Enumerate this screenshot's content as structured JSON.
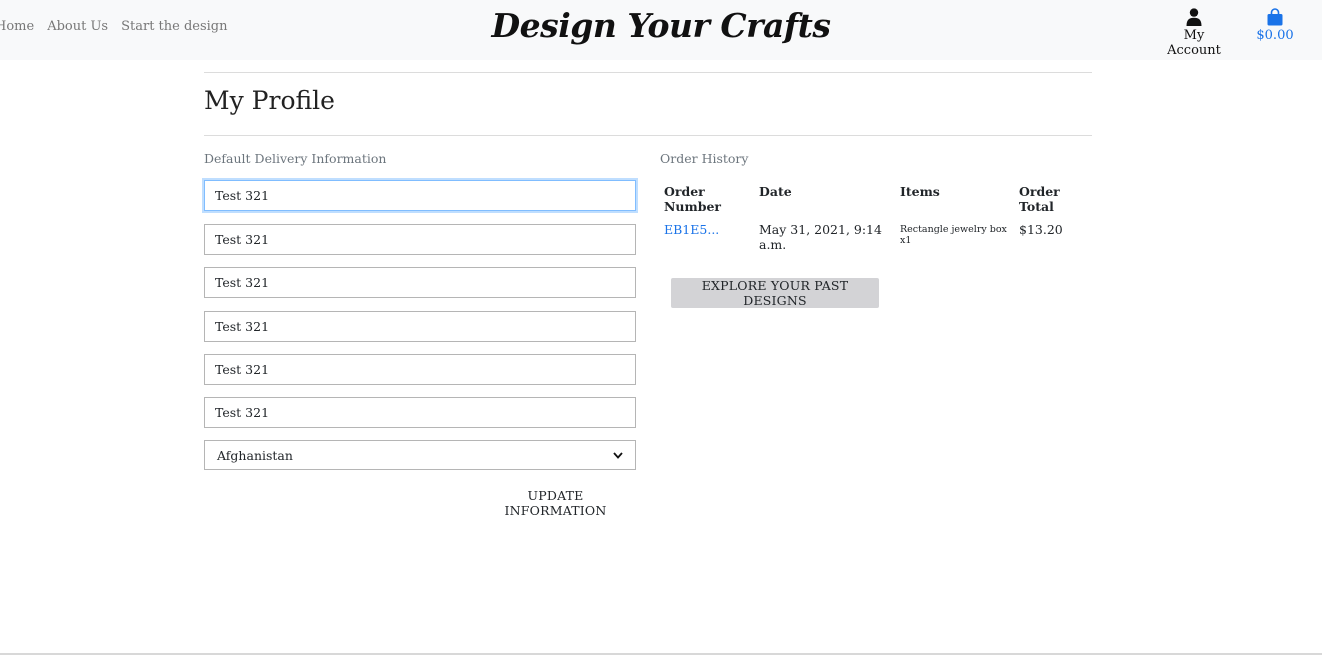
{
  "nav": {
    "items": [
      "Home",
      "About Us",
      "Start the design"
    ]
  },
  "brand": {
    "title": "Design Your Crafts"
  },
  "account": {
    "label": "My Account",
    "icon": "user-icon"
  },
  "cart": {
    "total": "$0.00",
    "icon": "shopping-bag-icon",
    "color": "#1a73e8"
  },
  "page": {
    "title": "My Profile"
  },
  "delivery": {
    "label": "Default Delivery Information",
    "fields": [
      "Test 321",
      "Test 321",
      "Test 321",
      "Test 321",
      "Test 321",
      "Test 321"
    ],
    "country": "Afghanistan",
    "update_label": "UPDATE INFORMATION"
  },
  "history": {
    "label": "Order History",
    "columns": [
      "Order Number",
      "Date",
      "Items",
      "Order Total"
    ],
    "rows": [
      {
        "order_number": "EB1E5...",
        "date": "May 31, 2021, 9:14 a.m.",
        "items": "Rectangle jewelry box x1",
        "total": "$13.20"
      }
    ],
    "explore_label": "EXPLORE YOUR PAST DESIGNS"
  }
}
